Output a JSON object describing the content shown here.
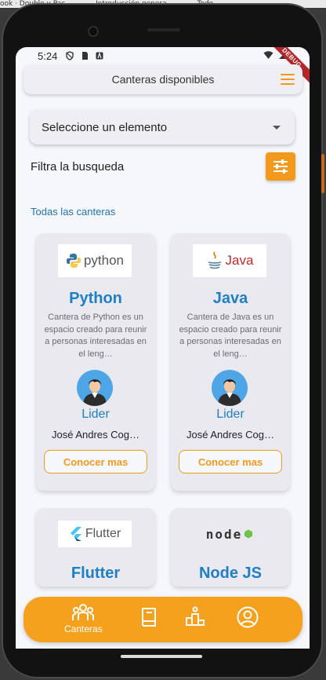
{
  "desktop": {
    "tabs": [
      "ook · Double y Pac",
      "Introducción genera",
      "Todo"
    ]
  },
  "status_bar": {
    "time": "5:24",
    "debug_banner": "DEBUG"
  },
  "app_bar": {
    "title": "Canteras disponibles",
    "menu_icon": "hamburger-menu-icon"
  },
  "dropdown": {
    "placeholder": "Seleccione un elemento"
  },
  "filter": {
    "label": "Filtra la busqueda",
    "icon": "tune-sliders-icon"
  },
  "section": {
    "title": "Todas las canteras"
  },
  "cards": [
    {
      "logo_text": "python",
      "title": "Python",
      "description": "Cantera de Python es un espacio creado para reunir a personas interesadas en el leng…",
      "role": "Lider",
      "leader": "José Andres Cog…",
      "button": "Conocer mas"
    },
    {
      "logo_text": "Java",
      "title": "Java",
      "description": "Cantera de Java es un espacio creado para reunir a personas interesadas en el leng…",
      "role": "Lider",
      "leader": "José Andres Cog…",
      "button": "Conocer mas"
    },
    {
      "logo_text": "Flutter",
      "title": "Flutter"
    },
    {
      "logo_text": "node",
      "title": "Node JS"
    }
  ],
  "bottom_nav": {
    "items": [
      {
        "label": "Canteras",
        "icon": "group-icon"
      },
      {
        "label": "",
        "icon": "book-icon"
      },
      {
        "label": "",
        "icon": "podium-icon"
      },
      {
        "label": "",
        "icon": "account-circle-icon"
      }
    ]
  },
  "colors": {
    "accent": "#f39a1c",
    "title_blue": "#1f7fc4",
    "background": "#f6f7fb"
  }
}
